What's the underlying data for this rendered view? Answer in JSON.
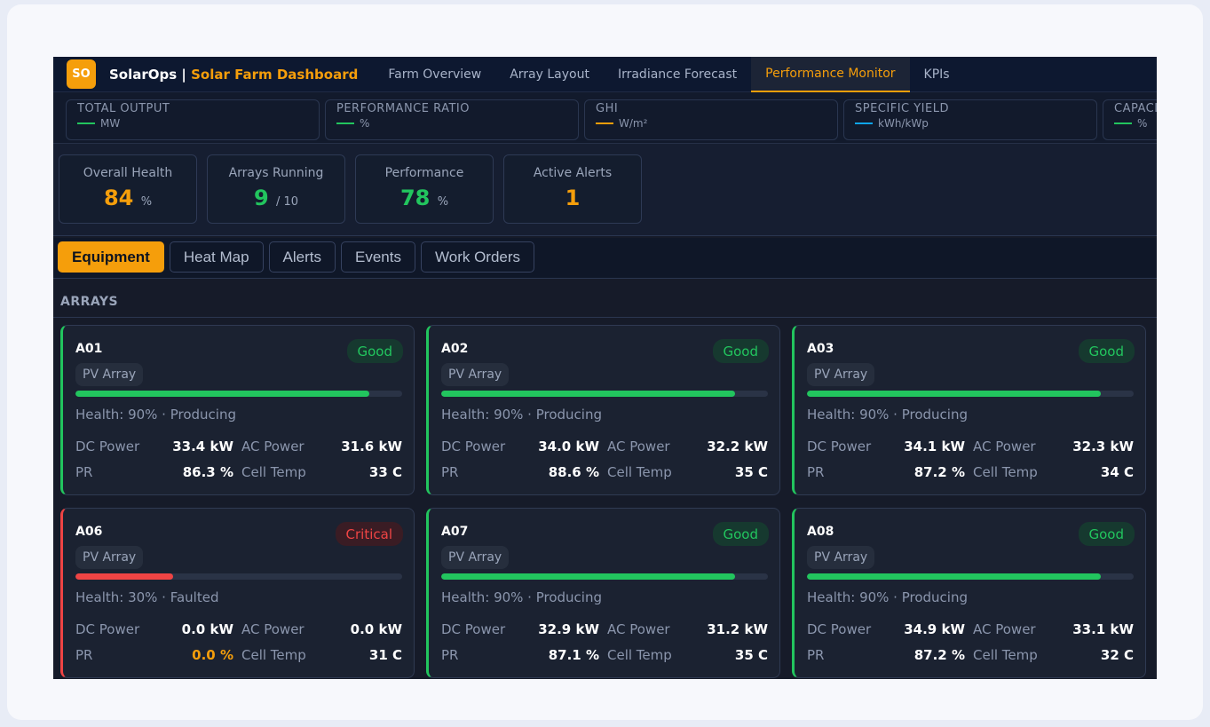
{
  "app": {
    "logo_text": "SO",
    "brand_name": "SolarOps",
    "brand_sep": " | ",
    "brand_title": "Solar Farm Dashboard",
    "accent_color": "#f59e0b"
  },
  "nav": {
    "tabs": [
      {
        "label": "Farm Overview",
        "active": false
      },
      {
        "label": "Array Layout",
        "active": false
      },
      {
        "label": "Irradiance Forecast",
        "active": false
      },
      {
        "label": "Performance Monitor",
        "active": true
      },
      {
        "label": "KPIs",
        "active": false
      }
    ]
  },
  "metrics": [
    {
      "label": "TOTAL OUTPUT",
      "unit": "MW",
      "color": "#22c55e"
    },
    {
      "label": "PERFORMANCE RATIO",
      "unit": "%",
      "color": "#22c55e"
    },
    {
      "label": "GHI",
      "unit": "W/m²",
      "color": "#f59e0b"
    },
    {
      "label": "SPECIFIC YIELD",
      "unit": "kWh/kWp",
      "color": "#0ea5e9"
    },
    {
      "label": "CAPACITY FACTOR",
      "unit": "%",
      "color": "#22c55e"
    }
  ],
  "summary": [
    {
      "label": "Overall Health",
      "value": "84",
      "unit": "%",
      "color": "#f59e0b"
    },
    {
      "label": "Arrays Running",
      "value": "9",
      "unit": "/ 10",
      "color": "#22c55e"
    },
    {
      "label": "Performance",
      "value": "78",
      "unit": "%",
      "color": "#22c55e"
    },
    {
      "label": "Active Alerts",
      "value": "1",
      "unit": "",
      "color": "#f59e0b"
    }
  ],
  "subtabs": [
    {
      "label": "Equipment",
      "active": true
    },
    {
      "label": "Heat Map",
      "active": false
    },
    {
      "label": "Alerts",
      "active": false
    },
    {
      "label": "Events",
      "active": false
    },
    {
      "label": "Work Orders",
      "active": false
    }
  ],
  "section_title": "ARRAYS",
  "arrays": [
    {
      "id": "A01",
      "status": "Good",
      "status_class": "good",
      "type": "PV Array",
      "health_pct": 90,
      "health_text": "Health: 90% · Producing",
      "dc_label": "DC Power",
      "dc": "33.4 kW",
      "ac_label": "AC Power",
      "ac": "31.6 kW",
      "pr_label": "PR",
      "pr": "86.3 %",
      "pr_color": "#ffffff",
      "temp_label": "Cell Temp",
      "temp": "33 C"
    },
    {
      "id": "A02",
      "status": "Good",
      "status_class": "good",
      "type": "PV Array",
      "health_pct": 90,
      "health_text": "Health: 90% · Producing",
      "dc_label": "DC Power",
      "dc": "34.0 kW",
      "ac_label": "AC Power",
      "ac": "32.2 kW",
      "pr_label": "PR",
      "pr": "88.6 %",
      "pr_color": "#ffffff",
      "temp_label": "Cell Temp",
      "temp": "35 C"
    },
    {
      "id": "A03",
      "status": "Good",
      "status_class": "good",
      "type": "PV Array",
      "health_pct": 90,
      "health_text": "Health: 90% · Producing",
      "dc_label": "DC Power",
      "dc": "34.1 kW",
      "ac_label": "AC Power",
      "ac": "32.3 kW",
      "pr_label": "PR",
      "pr": "87.2 %",
      "pr_color": "#ffffff",
      "temp_label": "Cell Temp",
      "temp": "34 C"
    },
    {
      "id": "A06",
      "status": "Critical",
      "status_class": "critical",
      "type": "PV Array",
      "health_pct": 30,
      "health_text": "Health: 30% · Faulted",
      "dc_label": "DC Power",
      "dc": "0.0 kW",
      "ac_label": "AC Power",
      "ac": "0.0 kW",
      "pr_label": "PR",
      "pr": "0.0 %",
      "pr_color": "#f59e0b",
      "temp_label": "Cell Temp",
      "temp": "31 C"
    },
    {
      "id": "A07",
      "status": "Good",
      "status_class": "good",
      "type": "PV Array",
      "health_pct": 90,
      "health_text": "Health: 90% · Producing",
      "dc_label": "DC Power",
      "dc": "32.9 kW",
      "ac_label": "AC Power",
      "ac": "31.2 kW",
      "pr_label": "PR",
      "pr": "87.1 %",
      "pr_color": "#ffffff",
      "temp_label": "Cell Temp",
      "temp": "35 C"
    },
    {
      "id": "A08",
      "status": "Good",
      "status_class": "good",
      "type": "PV Array",
      "health_pct": 90,
      "health_text": "Health: 90% · Producing",
      "dc_label": "DC Power",
      "dc": "34.9 kW",
      "ac_label": "AC Power",
      "ac": "33.1 kW",
      "pr_label": "PR",
      "pr": "87.2 %",
      "pr_color": "#ffffff",
      "temp_label": "Cell Temp",
      "temp": "32 C"
    }
  ]
}
